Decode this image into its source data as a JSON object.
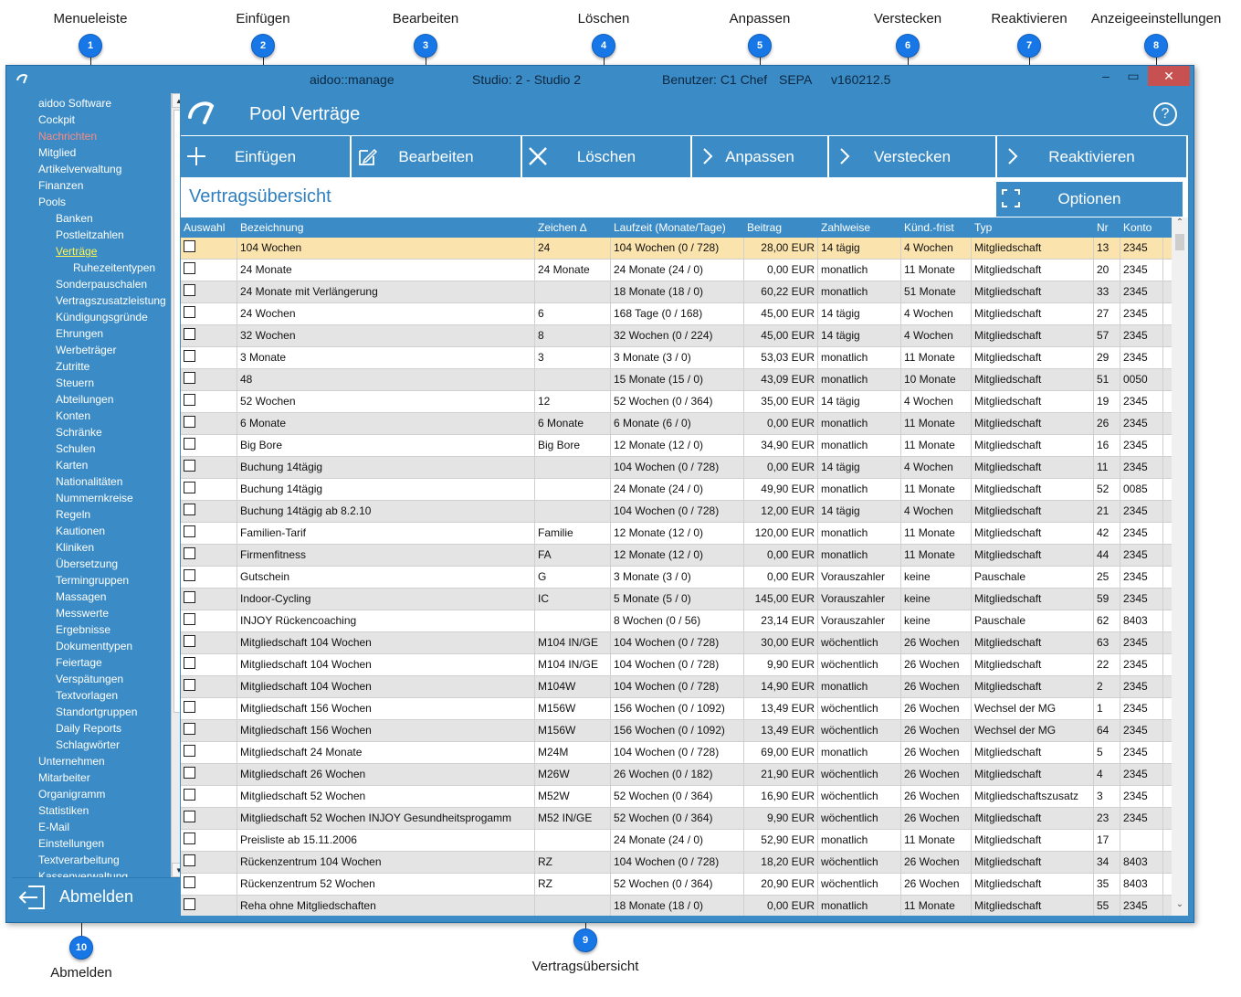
{
  "callouts": [
    {
      "num": "1",
      "label": "Menueleiste"
    },
    {
      "num": "2",
      "label": "Einfügen"
    },
    {
      "num": "3",
      "label": "Bearbeiten"
    },
    {
      "num": "4",
      "label": "Löschen"
    },
    {
      "num": "5",
      "label": "Anpassen"
    },
    {
      "num": "6",
      "label": "Verstecken"
    },
    {
      "num": "7",
      "label": "Reaktivieren"
    },
    {
      "num": "8",
      "label": "Anzeigeeinstellungen"
    },
    {
      "num": "9",
      "label": "Vertragsübersicht"
    },
    {
      "num": "10",
      "label": "Abmelden"
    }
  ],
  "titlebar": {
    "app": "aidoo::manage",
    "studio": "Studio: 2 - Studio 2",
    "user": "Benutzer: C1 Chef",
    "mode": "SEPA",
    "version": "v160212.5"
  },
  "sidebar": {
    "items": [
      {
        "label": "aidoo Software",
        "level": 0,
        "state": "normal"
      },
      {
        "label": "Cockpit",
        "level": 0,
        "state": "normal"
      },
      {
        "label": "Nachrichten",
        "level": 0,
        "state": "red"
      },
      {
        "label": "Mitglied",
        "level": 0,
        "state": "normal"
      },
      {
        "label": "Artikelverwaltung",
        "level": 0,
        "state": "normal"
      },
      {
        "label": "Finanzen",
        "level": 0,
        "state": "normal"
      },
      {
        "label": "Pools",
        "level": 0,
        "state": "normal"
      },
      {
        "label": "Banken",
        "level": 1,
        "state": "normal"
      },
      {
        "label": "Postleitzahlen",
        "level": 1,
        "state": "normal"
      },
      {
        "label": "Verträge",
        "level": 1,
        "state": "active"
      },
      {
        "label": "Ruhezeitentypen",
        "level": 2,
        "state": "normal"
      },
      {
        "label": "Sonderpauschalen",
        "level": 1,
        "state": "normal"
      },
      {
        "label": "Vertragszusatzleistung",
        "level": 1,
        "state": "normal"
      },
      {
        "label": "Kündigungsgründe",
        "level": 1,
        "state": "normal"
      },
      {
        "label": "Ehrungen",
        "level": 1,
        "state": "normal"
      },
      {
        "label": "Werbeträger",
        "level": 1,
        "state": "normal"
      },
      {
        "label": "Zutritte",
        "level": 1,
        "state": "normal"
      },
      {
        "label": "Steuern",
        "level": 1,
        "state": "normal"
      },
      {
        "label": "Abteilungen",
        "level": 1,
        "state": "normal"
      },
      {
        "label": "Konten",
        "level": 1,
        "state": "normal"
      },
      {
        "label": "Schränke",
        "level": 1,
        "state": "normal"
      },
      {
        "label": "Schulen",
        "level": 1,
        "state": "normal"
      },
      {
        "label": "Karten",
        "level": 1,
        "state": "normal"
      },
      {
        "label": "Nationalitäten",
        "level": 1,
        "state": "normal"
      },
      {
        "label": "Nummernkreise",
        "level": 1,
        "state": "normal"
      },
      {
        "label": "Regeln",
        "level": 1,
        "state": "normal"
      },
      {
        "label": "Kautionen",
        "level": 1,
        "state": "normal"
      },
      {
        "label": "Kliniken",
        "level": 1,
        "state": "normal"
      },
      {
        "label": "Übersetzung",
        "level": 1,
        "state": "normal"
      },
      {
        "label": "Termingruppen",
        "level": 1,
        "state": "normal"
      },
      {
        "label": "Massagen",
        "level": 1,
        "state": "normal"
      },
      {
        "label": "Messwerte",
        "level": 1,
        "state": "normal"
      },
      {
        "label": "Ergebnisse",
        "level": 1,
        "state": "normal"
      },
      {
        "label": "Dokumenttypen",
        "level": 1,
        "state": "normal"
      },
      {
        "label": "Feiertage",
        "level": 1,
        "state": "normal"
      },
      {
        "label": "Verspätungen",
        "level": 1,
        "state": "normal"
      },
      {
        "label": "Textvorlagen",
        "level": 1,
        "state": "normal"
      },
      {
        "label": "Standortgruppen",
        "level": 1,
        "state": "normal"
      },
      {
        "label": "Daily Reports",
        "level": 1,
        "state": "normal"
      },
      {
        "label": "Schlagwörter",
        "level": 1,
        "state": "normal"
      },
      {
        "label": "Unternehmen",
        "level": 0,
        "state": "normal"
      },
      {
        "label": "Mitarbeiter",
        "level": 0,
        "state": "normal"
      },
      {
        "label": "Organigramm",
        "level": 0,
        "state": "normal"
      },
      {
        "label": "Statistiken",
        "level": 0,
        "state": "normal"
      },
      {
        "label": "E-Mail",
        "level": 0,
        "state": "normal"
      },
      {
        "label": "Einstellungen",
        "level": 0,
        "state": "normal"
      },
      {
        "label": "Textverarbeitung",
        "level": 0,
        "state": "normal"
      },
      {
        "label": "Kassenverwaltung",
        "level": 0,
        "state": "normal"
      }
    ],
    "logout_label": "Abmelden"
  },
  "header": {
    "title": "Pool Verträge",
    "help": "?"
  },
  "toolbar": {
    "buttons": [
      {
        "label": "Einfügen",
        "icon": "plus-icon"
      },
      {
        "label": "Bearbeiten",
        "icon": "edit-icon"
      },
      {
        "label": "Löschen",
        "icon": "close-icon"
      },
      {
        "label": "Anpassen",
        "icon": "chevron-right-icon"
      },
      {
        "label": "Verstecken",
        "icon": "chevron-right-icon"
      },
      {
        "label": "Reaktivieren",
        "icon": "chevron-right-icon"
      }
    ],
    "options_label": "Optionen"
  },
  "section_title": "Vertragsübersicht",
  "table": {
    "columns": [
      "Auswahl",
      "Bezeichnung",
      "Zeichen ∆",
      "Laufzeit (Monate/Tage)",
      "Beitrag",
      "Zahlweise",
      "Künd.-frist",
      "Typ",
      "Nr",
      "Konto"
    ],
    "rows": [
      [
        "",
        "104 Wochen",
        "24",
        "104 Wochen (0 / 728)",
        "28,00 EUR",
        "14 tägig",
        "4 Wochen",
        "Mitgliedschaft",
        "13",
        "2345"
      ],
      [
        "",
        "24 Monate",
        "24 Monate",
        "24 Monate (24 / 0)",
        "0,00 EUR",
        "monatlich",
        "11 Monate",
        "Mitgliedschaft",
        "20",
        "2345"
      ],
      [
        "",
        "24 Monate mit Verlängerung",
        "",
        "18 Monate (18 / 0)",
        "60,22 EUR",
        "monatlich",
        "51 Monate",
        "Mitgliedschaft",
        "33",
        "2345"
      ],
      [
        "",
        "24 Wochen",
        "6",
        "168 Tage (0 / 168)",
        "45,00 EUR",
        "14 tägig",
        "4 Wochen",
        "Mitgliedschaft",
        "27",
        "2345"
      ],
      [
        "",
        "32 Wochen",
        "8",
        "32 Wochen (0 / 224)",
        "45,00 EUR",
        "14 tägig",
        "4 Wochen",
        "Mitgliedschaft",
        "57",
        "2345"
      ],
      [
        "",
        "3 Monate",
        "3",
        "3 Monate (3 / 0)",
        "53,03 EUR",
        "monatlich",
        "11 Monate",
        "Mitgliedschaft",
        "29",
        "2345"
      ],
      [
        "",
        "48",
        "",
        "15 Monate (15 / 0)",
        "43,09 EUR",
        "monatlich",
        "10 Monate",
        "Mitgliedschaft",
        "51",
        "0050"
      ],
      [
        "",
        "52 Wochen",
        "12",
        "52 Wochen (0 / 364)",
        "35,00 EUR",
        "14 tägig",
        "4 Wochen",
        "Mitgliedschaft",
        "19",
        "2345"
      ],
      [
        "",
        "6 Monate",
        "6 Monate",
        "6 Monate (6 / 0)",
        "0,00 EUR",
        "monatlich",
        "11 Monate",
        "Mitgliedschaft",
        "26",
        "2345"
      ],
      [
        "",
        "Big Bore",
        "Big Bore",
        "12 Monate (12 / 0)",
        "34,90 EUR",
        "monatlich",
        "11 Monate",
        "Mitgliedschaft",
        "16",
        "2345"
      ],
      [
        "",
        "Buchung 14tägig",
        "",
        "104 Wochen (0 / 728)",
        "0,00 EUR",
        "14 tägig",
        "4 Wochen",
        "Mitgliedschaft",
        "11",
        "2345"
      ],
      [
        "",
        "Buchung 14tägig",
        "",
        "24 Monate (24 / 0)",
        "49,90 EUR",
        "monatlich",
        "11 Monate",
        "Mitgliedschaft",
        "52",
        "0085"
      ],
      [
        "",
        "Buchung 14tägig ab 8.2.10",
        "",
        "104 Wochen (0 / 728)",
        "12,00 EUR",
        "14 tägig",
        "4 Wochen",
        "Mitgliedschaft",
        "21",
        "2345"
      ],
      [
        "",
        "Familien-Tarif",
        "Familie",
        "12 Monate (12 / 0)",
        "120,00 EUR",
        "monatlich",
        "11 Monate",
        "Mitgliedschaft",
        "42",
        "2345"
      ],
      [
        "",
        "Firmenfitness",
        "FA",
        "12 Monate (12 / 0)",
        "0,00 EUR",
        "monatlich",
        "11 Monate",
        "Mitgliedschaft",
        "44",
        "2345"
      ],
      [
        "",
        "Gutschein",
        "G",
        "3 Monate (3 / 0)",
        "0,00 EUR",
        "Vorauszahler",
        "keine",
        "Pauschale",
        "25",
        "2345"
      ],
      [
        "",
        "Indoor-Cycling",
        "IC",
        "5 Monate (5 / 0)",
        "145,00 EUR",
        "Vorauszahler",
        "keine",
        "Mitgliedschaft",
        "59",
        "2345"
      ],
      [
        "",
        "INJOY Rückencoaching",
        "",
        "8 Wochen (0 / 56)",
        "23,14 EUR",
        "Vorauszahler",
        "keine",
        "Pauschale",
        "62",
        "8403"
      ],
      [
        "",
        "Mitgliedschaft 104 Wochen",
        "M104 IN/GE",
        "104 Wochen (0 / 728)",
        "30,00 EUR",
        "wöchentlich",
        "26 Wochen",
        "Mitgliedschaft",
        "63",
        "2345"
      ],
      [
        "",
        "Mitgliedschaft 104 Wochen",
        "M104 IN/GE",
        "104 Wochen (0 / 728)",
        "9,90 EUR",
        "wöchentlich",
        "26 Wochen",
        "Mitgliedschaft",
        "22",
        "2345"
      ],
      [
        "",
        "Mitgliedschaft 104 Wochen",
        "M104W",
        "104 Wochen (0 / 728)",
        "14,90 EUR",
        "monatlich",
        "26 Wochen",
        "Mitgliedschaft",
        "2",
        "2345"
      ],
      [
        "",
        "Mitgliedschaft 156 Wochen",
        "M156W",
        "156 Wochen (0 / 1092)",
        "13,49 EUR",
        "wöchentlich",
        "26 Wochen",
        "Wechsel der MG",
        "1",
        "2345"
      ],
      [
        "",
        "Mitgliedschaft 156 Wochen",
        "M156W",
        "156 Wochen (0 / 1092)",
        "13,49 EUR",
        "wöchentlich",
        "26 Wochen",
        "Wechsel der MG",
        "64",
        "2345"
      ],
      [
        "",
        "Mitgliedschaft 24 Monate",
        "M24M",
        "104 Wochen (0 / 728)",
        "69,00 EUR",
        "monatlich",
        "26 Wochen",
        "Mitgliedschaft",
        "5",
        "2345"
      ],
      [
        "",
        "Mitgliedschaft 26 Wochen",
        "M26W",
        "26 Wochen (0 / 182)",
        "21,90 EUR",
        "wöchentlich",
        "26 Wochen",
        "Mitgliedschaft",
        "4",
        "2345"
      ],
      [
        "",
        "Mitgliedschaft 52 Wochen",
        "M52W",
        "52 Wochen (0 / 364)",
        "16,90 EUR",
        "wöchentlich",
        "26 Wochen",
        "Mitgliedschaftszusatz",
        "3",
        "2345"
      ],
      [
        "",
        "Mitgliedschaft 52 Wochen INJOY Gesundheitsprogamm",
        "M52 IN/GE",
        "52 Wochen (0 / 364)",
        "9,90 EUR",
        "wöchentlich",
        "26 Wochen",
        "Mitgliedschaft",
        "23",
        "2345"
      ],
      [
        "",
        "Preisliste ab 15.11.2006",
        "",
        "24 Monate (24 / 0)",
        "52,90 EUR",
        "monatlich",
        "11 Monate",
        "Mitgliedschaft",
        "17",
        ""
      ],
      [
        "",
        "Rückenzentrum 104 Wochen",
        "RZ",
        "104 Wochen (0 / 728)",
        "18,20 EUR",
        "wöchentlich",
        "26 Wochen",
        "Mitgliedschaft",
        "34",
        "8403"
      ],
      [
        "",
        "Rückenzentrum 52 Wochen",
        "RZ",
        "52 Wochen (0 / 364)",
        "20,90 EUR",
        "wöchentlich",
        "26 Wochen",
        "Mitgliedschaft",
        "35",
        "8403"
      ],
      [
        "",
        "Reha ohne Mitgliedschaften",
        "",
        "18 Monate (18 / 0)",
        "0,00 EUR",
        "monatlich",
        "11 Monate",
        "Mitgliedschaft",
        "55",
        "2345"
      ]
    ]
  },
  "colors": {
    "accent": "#3b8cc6",
    "badge": "#1877e6",
    "selected_row": "#fbe3ad",
    "alt_row": "#e4e4e4",
    "nav_active": "#fff44f",
    "nav_alert": "#ff8a80"
  }
}
